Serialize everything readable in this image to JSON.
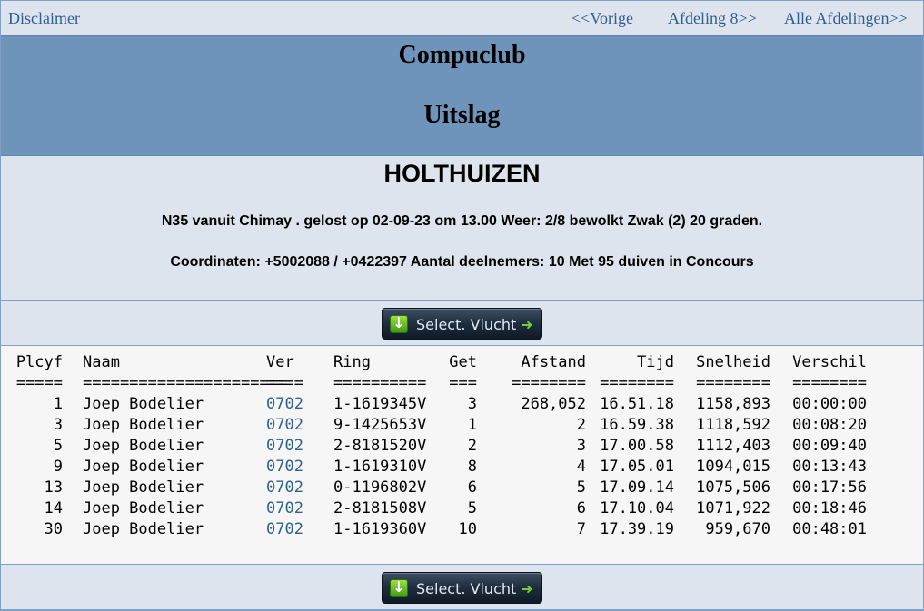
{
  "nav": {
    "disclaimer": "Disclaimer",
    "prev": "<<Vorige",
    "afdeling": "Afdeling 8>>",
    "all": "Alle Afdelingen>>"
  },
  "header": {
    "club": "Compuclub",
    "subtitle": "Uitslag"
  },
  "race": {
    "place": "HOLTHUIZEN",
    "line1": "N35 vanuit Chimay . gelost op 02-09-23 om 13.00 Weer: 2/8 bewolkt Zwak (2) 20 graden.",
    "line2": "Coordinaten: +5002088 / +0422397 Aantal deelnemers: 10 Met 95 duiven in Concours"
  },
  "buttons": {
    "select_label": "Select. Vlucht"
  },
  "table": {
    "headers": [
      "Plcyf",
      "Naam",
      "Ver",
      "Ring",
      "Get",
      "Afstand",
      "Tijd",
      "Snelheid",
      "Verschil"
    ],
    "separators": [
      "=====",
      "======================",
      "====",
      "==========",
      "===",
      "========",
      "========",
      "========",
      "========"
    ],
    "rows": [
      [
        "1",
        "Joep Bodelier",
        "0702",
        "1-1619345V",
        "3",
        "268,052",
        "16.51.18",
        "1158,893",
        "00:00:00"
      ],
      [
        "3",
        "Joep Bodelier",
        "0702",
        "9-1425653V",
        "1",
        "2",
        "16.59.38",
        "1118,592",
        "00:08:20"
      ],
      [
        "5",
        "Joep Bodelier",
        "0702",
        "2-8181520V",
        "2",
        "3",
        "17.00.58",
        "1112,403",
        "00:09:40"
      ],
      [
        "9",
        "Joep Bodelier",
        "0702",
        "1-1619310V",
        "8",
        "4",
        "17.05.01",
        "1094,015",
        "00:13:43"
      ],
      [
        "13",
        "Joep Bodelier",
        "0702",
        "0-1196802V",
        "6",
        "5",
        "17.09.14",
        "1075,506",
        "00:17:56"
      ],
      [
        "14",
        "Joep Bodelier",
        "0702",
        "2-8181508V",
        "5",
        "6",
        "17.10.04",
        "1071,922",
        "00:18:46"
      ],
      [
        "30",
        "Joep Bodelier",
        "0702",
        "1-1619360V",
        "10",
        "7",
        "17.39.19",
        "959,670",
        "00:48:01"
      ]
    ]
  },
  "colors": {
    "header_band": "#6f94bb",
    "page_bg": "#dde4ee",
    "link": "#2f5f8f"
  },
  "icons": [
    "download-icon",
    "arrow-right-icon"
  ]
}
